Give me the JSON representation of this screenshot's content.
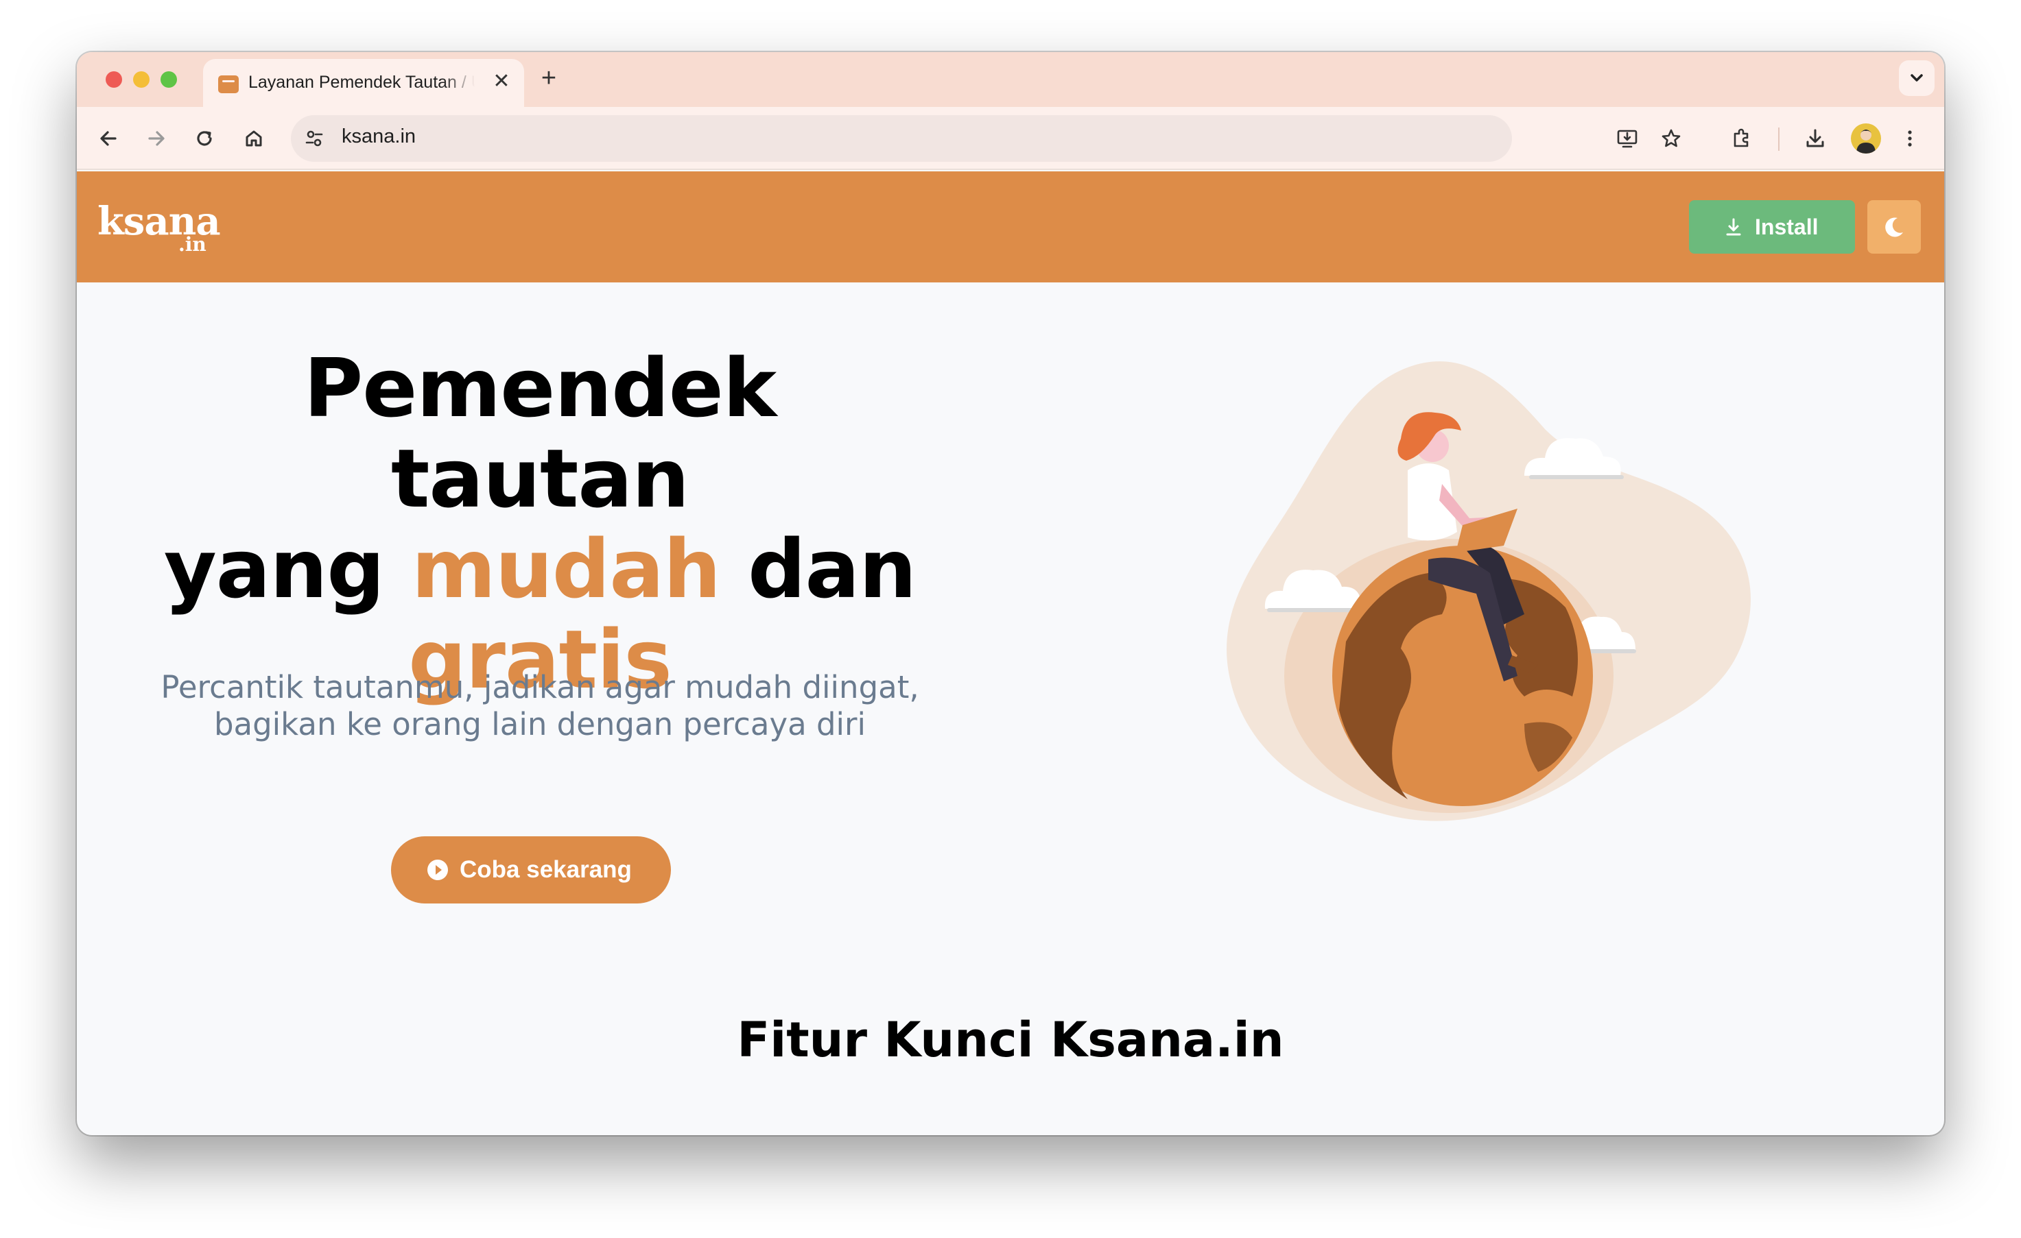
{
  "browser": {
    "tab_title": "Layanan Pemendek Tautan / Unduh",
    "tab_close": "✕",
    "new_tab": "+",
    "url": "ksana.in"
  },
  "header": {
    "logo_main": "ksana",
    "logo_sub": ".in",
    "install_label": "Install",
    "brand_color": "#dd8c48",
    "install_color": "#6cba7c"
  },
  "hero": {
    "title_line1": "Pemendek tautan",
    "title_yang": "yang ",
    "title_mudah": "mudah",
    "title_dan": " dan",
    "title_gratis": "gratis",
    "subtitle": "Percantik tautanmu, jadikan agar mudah diingat, bagikan ke orang lain dengan percaya diri",
    "cta_label": "Coba sekarang"
  },
  "features": {
    "title": "Fitur Kunci Ksana.in"
  }
}
